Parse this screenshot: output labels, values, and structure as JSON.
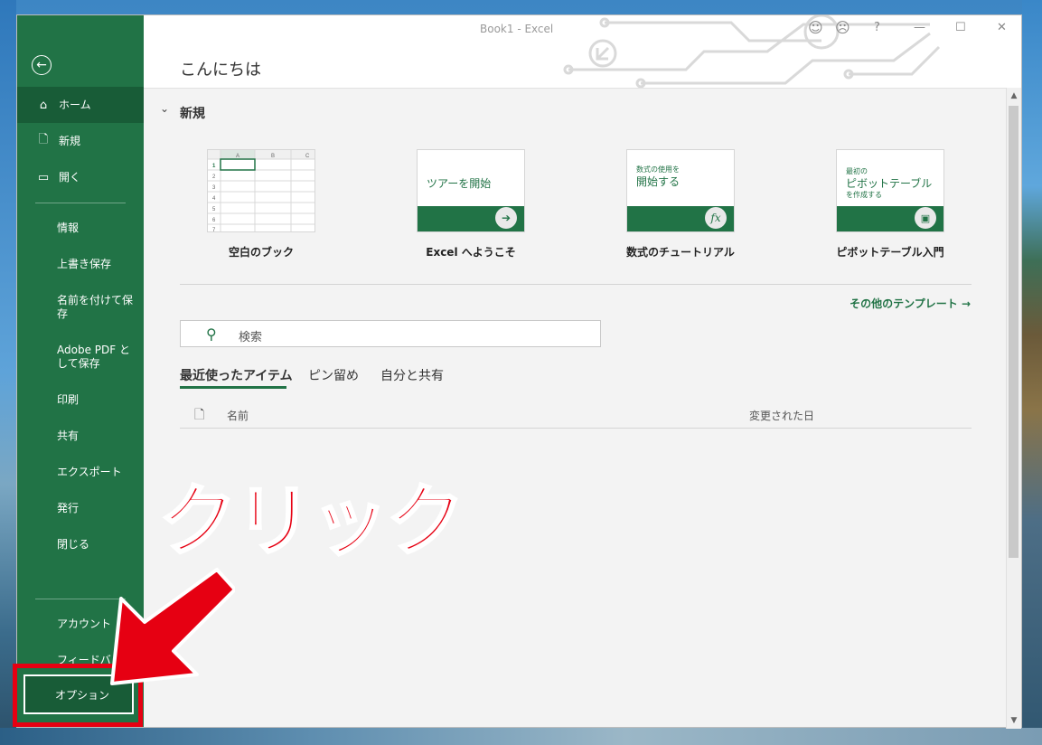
{
  "window": {
    "title": "Book1  -  Excel",
    "help": "?",
    "minimize": "—",
    "maximize": "☐",
    "close": "✕",
    "smile": "☺",
    "frown": "☹"
  },
  "greeting": "こんにちは",
  "nav": {
    "back_icon": "arrow-left-icon",
    "home": "ホーム",
    "new": "新規",
    "open": "開く",
    "info": "情報",
    "save": "上書き保存",
    "save_as": "名前を付けて保存",
    "save_pdf": "Adobe PDF として保存",
    "print": "印刷",
    "share": "共有",
    "export": "エクスポート",
    "publish": "発行",
    "close": "閉じる",
    "account": "アカウント",
    "feedback": "フィードバック",
    "options": "オプション"
  },
  "new_section": {
    "chevron": "⌄",
    "title": "新規",
    "templates": [
      {
        "label": "空白のブック"
      },
      {
        "label": "Excel へようこそ",
        "thumb_text": "ツアーを開始"
      },
      {
        "label": "数式のチュートリアル",
        "thumb_small": "数式の使用を",
        "thumb_big": "開始する"
      },
      {
        "label": "ピボットテーブル入門",
        "thumb_small": "最初の",
        "thumb_big": "ピボットテーブル",
        "thumb_small2": "を作成する"
      }
    ],
    "blank_grid": {
      "cols": [
        "A",
        "B",
        "C"
      ],
      "rows": [
        "1",
        "2",
        "3",
        "4",
        "5",
        "6",
        "7"
      ]
    },
    "more_templates": "その他のテンプレート →"
  },
  "search": {
    "placeholder": "検索"
  },
  "tabs": [
    {
      "label": "最近使ったアイテム",
      "active": true
    },
    {
      "label": "ピン留め"
    },
    {
      "label": "自分と共有"
    }
  ],
  "table": {
    "col_name": "名前",
    "col_modified": "変更された日"
  },
  "annotation": {
    "click_text": "クリック"
  },
  "colors": {
    "excel_green": "#217346",
    "active_green": "#185c37",
    "annotation_red": "#e60012"
  }
}
